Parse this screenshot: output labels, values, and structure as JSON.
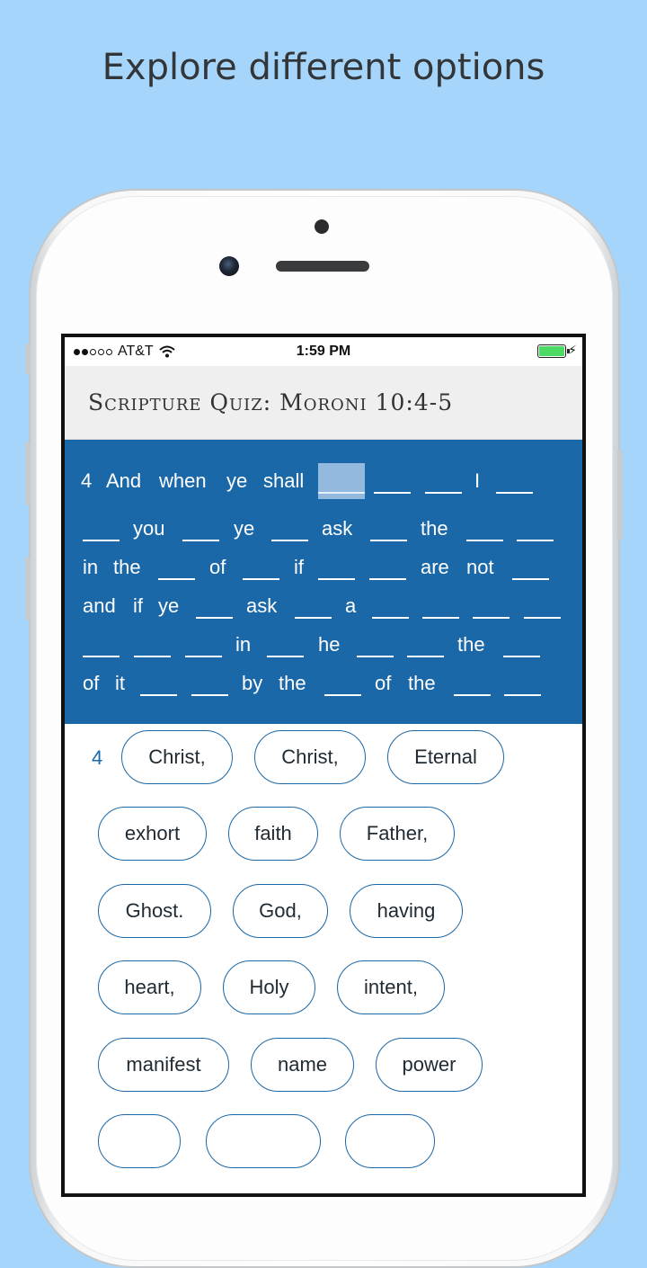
{
  "headline": "Explore different options",
  "status": {
    "carrier": "AT&T",
    "time": "1:59 PM",
    "signal_bars_filled": 2,
    "signal_bars_total": 5,
    "battery_level": 1.0,
    "battery_color": "#4cd964"
  },
  "quiz": {
    "title": "Scripture Quiz: Moroni 10:4-5",
    "verse_color": "#1b68a8",
    "verse_words": {
      "number": "4",
      "w_and": "And",
      "w_when": "when",
      "w_ye1": "ye",
      "w_shall": "shall",
      "w_I": "I",
      "w_you": "you",
      "w_ye2": "ye",
      "w_ask1": "ask",
      "w_the1": "the",
      "w_in1": "in",
      "w_the2": "the",
      "w_of1": "of",
      "w_if1": "if",
      "w_are": "are",
      "w_not": "not",
      "w_and2": "and",
      "w_if2": "if",
      "w_ye3": "ye",
      "w_ask2": "ask",
      "w_a": "a",
      "w_in2": "in",
      "w_he": "he",
      "w_the3": "the",
      "w_of2": "of",
      "w_it": "it",
      "w_by": "by",
      "w_the4": "the",
      "w_of3": "of",
      "w_the5": "the"
    },
    "verse_label": "4",
    "options": [
      "Christ,",
      "Christ,",
      "Eternal",
      "exhort",
      "faith",
      "Father,",
      "Ghost.",
      "God,",
      "having",
      "heart,",
      "Holy",
      "intent,",
      "manifest",
      "name",
      "power"
    ]
  }
}
